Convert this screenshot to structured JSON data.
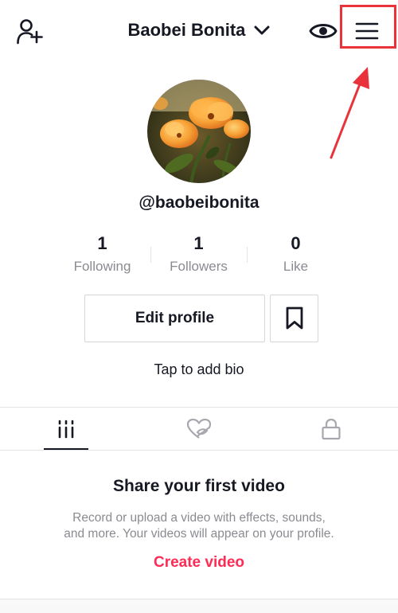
{
  "header": {
    "title": "Baobei Bonita",
    "icons": {
      "add_friend": "add-user-icon",
      "title_dropdown": "chevron-down-icon",
      "view_profile": "eye-icon",
      "menu": "hamburger-menu-icon"
    },
    "highlight_color": "#e8333a"
  },
  "profile": {
    "handle": "@baobeibonita",
    "avatar": "avatar-flowers-image",
    "stats": [
      {
        "value": "1",
        "label": "Following"
      },
      {
        "value": "1",
        "label": "Followers"
      },
      {
        "value": "0",
        "label": "Like"
      }
    ],
    "edit_label": "Edit profile",
    "bookmark_icon": "bookmark-icon",
    "bio_prompt": "Tap to add bio"
  },
  "tabs": [
    {
      "icon": "grid-icon",
      "active": true
    },
    {
      "icon": "liked-hidden-icon",
      "active": false
    },
    {
      "icon": "lock-icon",
      "active": false
    }
  ],
  "empty_state": {
    "title": "Share your first video",
    "description_line1": "Record or upload a video with effects, sounds,",
    "description_line2": "and more. Your videos will appear on your profile.",
    "cta": "Create video"
  },
  "colors": {
    "text": "#161823",
    "muted": "#8a8b91",
    "accent": "#fe2c55",
    "annotation": "#e8333a"
  }
}
